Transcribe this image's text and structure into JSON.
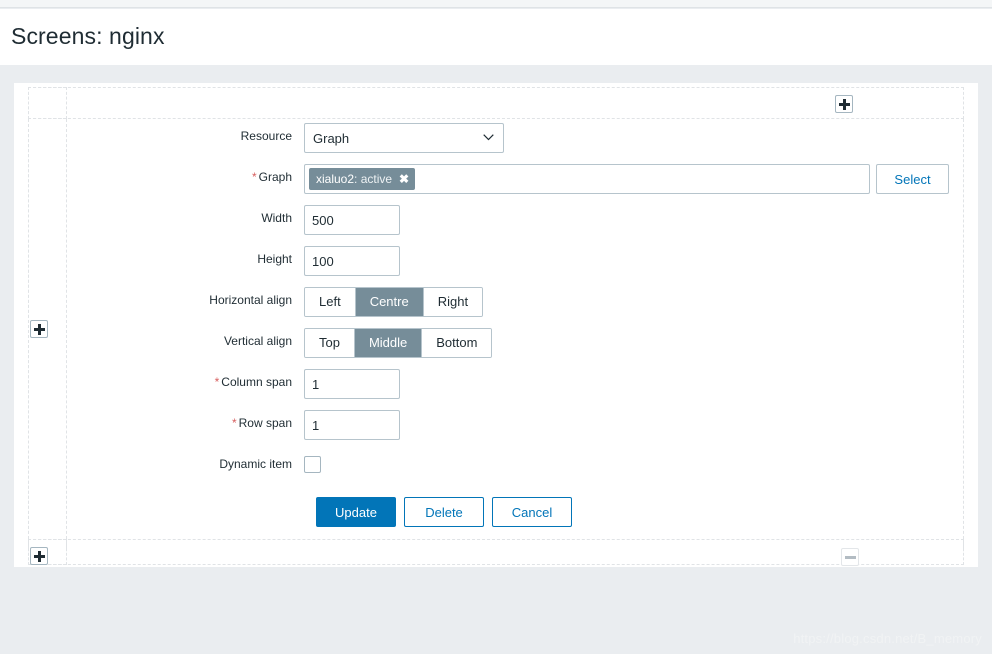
{
  "header": {
    "title": "Screens: nginx"
  },
  "grid": {
    "add_column_button": "+",
    "add_row_left_button": "+",
    "add_row_bottom_button": "+",
    "remove_button": "−"
  },
  "form": {
    "resource": {
      "label": "Resource",
      "value": "Graph",
      "options": [
        "Graph"
      ]
    },
    "graph": {
      "label": "Graph",
      "required": "*",
      "tag_host": "xialuo2",
      "tag_rest": ": active",
      "tag_remove": "✖",
      "select_button": "Select"
    },
    "width": {
      "label": "Width",
      "value": "500"
    },
    "height": {
      "label": "Height",
      "value": "100"
    },
    "horizontal_align": {
      "label": "Horizontal align",
      "options": [
        "Left",
        "Centre",
        "Right"
      ],
      "selected": "Centre"
    },
    "vertical_align": {
      "label": "Vertical align",
      "options": [
        "Top",
        "Middle",
        "Bottom"
      ],
      "selected": "Middle"
    },
    "column_span": {
      "label": "Column span",
      "required": "*",
      "value": "1"
    },
    "row_span": {
      "label": "Row span",
      "required": "*",
      "value": "1"
    },
    "dynamic_item": {
      "label": "Dynamic item",
      "checked": false
    },
    "actions": {
      "update": "Update",
      "delete": "Delete",
      "cancel": "Cancel"
    }
  },
  "watermark": {
    "text": "https://blog.csdn.net/B_memory"
  },
  "colors": {
    "accent_blue": "#0275b8",
    "selected_gray": "#768d99",
    "required_red": "#d75f5f",
    "page_bg": "#eaedf0",
    "border": "#b6c4cc"
  }
}
